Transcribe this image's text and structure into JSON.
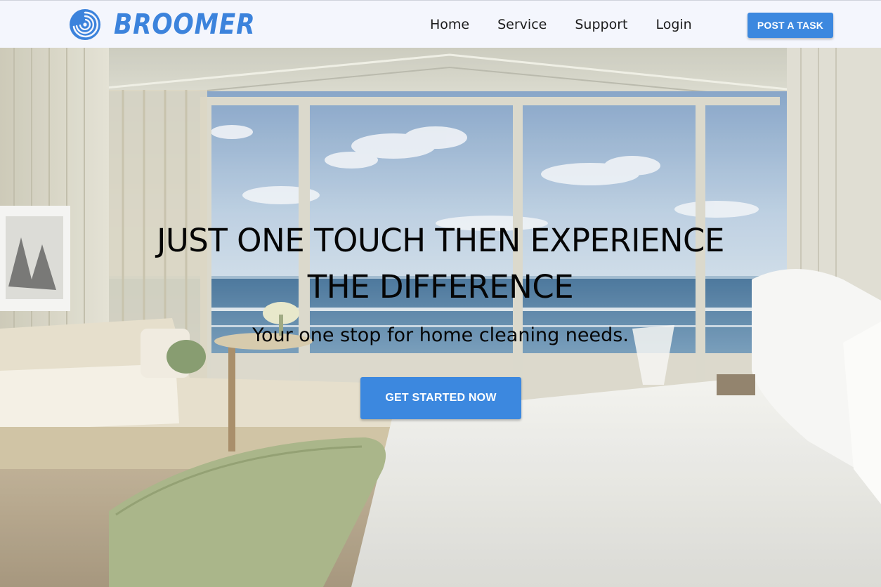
{
  "brand": {
    "name": "BROOMER",
    "logo_icon": "swirl-logo-icon",
    "color": "#3c83dc"
  },
  "nav": {
    "links": [
      {
        "label": "Home"
      },
      {
        "label": "Service"
      },
      {
        "label": "Support"
      },
      {
        "label": "Login"
      }
    ],
    "cta_label": "POST A TASK"
  },
  "hero": {
    "title_line1": "JUST ONE TOUCH THEN EXPERIENCE",
    "title_line2": "THE DIFFERENCE",
    "subtitle": "Your one stop for home cleaning needs.",
    "cta_label": "GET STARTED NOW",
    "background": "hotel-bedroom-ocean-view-photo"
  },
  "colors": {
    "accent": "#3c88df",
    "navbar_bg": "#f4f6fd",
    "heading_text": "#050505"
  }
}
